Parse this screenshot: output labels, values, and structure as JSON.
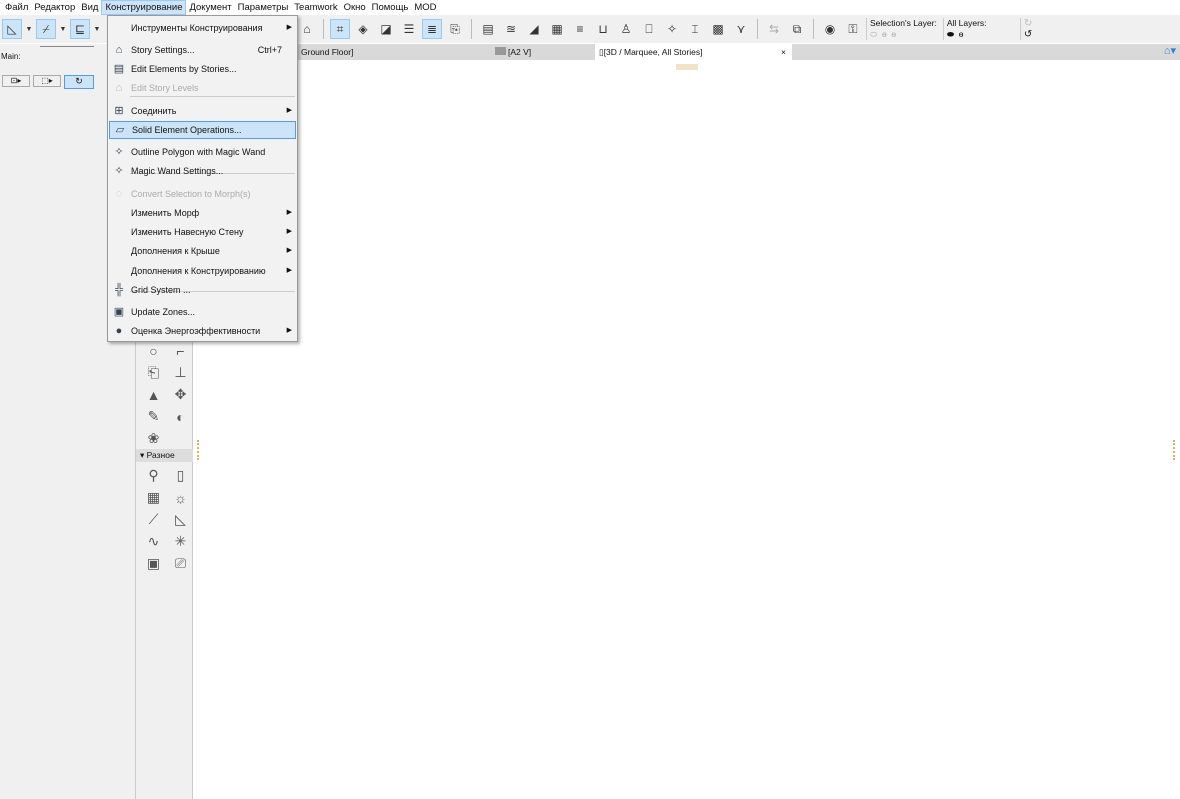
{
  "menubar": [
    "Файл",
    "Редактор",
    "Вид",
    "Конструирование",
    "Документ",
    "Параметры",
    "Teamwork",
    "Окно",
    "Помощь",
    "MOD"
  ],
  "active_menu": "Конструирование",
  "toolbar": {
    "selection_layer_label": "Selection's Layer:",
    "all_layers_label": "All Layers:"
  },
  "left_panel": {
    "main_label": "Main:"
  },
  "tabs": [
    "Ground Floor]",
    "[A2 V]",
    "[3D / Marquee, All Stories]"
  ],
  "tab_close": "×",
  "toolbox": {
    "group_label": "Разное",
    "icons1": [
      "○",
      "⌐",
      "⎗",
      "⊥",
      "▲",
      "✥",
      "✎",
      "◐",
      "❀"
    ],
    "icons2": [
      "⚲",
      "▯",
      "▦",
      "☼",
      "⟋",
      "◺",
      "∿",
      "✳",
      "▣",
      "⎚"
    ]
  },
  "menu": [
    {
      "label": "Инструменты Конструирования",
      "icon": "",
      "submenu": true
    },
    {
      "label": "Story Settings...",
      "icon": "⌂",
      "shortcut": "Ctrl+7"
    },
    {
      "label": "Edit Elements by Stories...",
      "icon": "▤"
    },
    {
      "label": "Edit Story Levels",
      "icon": "⌂",
      "disabled": true
    },
    {
      "label": "Соединить",
      "icon": "⊞",
      "submenu": true
    },
    {
      "label": "Solid Element Operations...",
      "icon": "▱",
      "highlighted": true
    },
    {
      "label": "Outline Polygon with Magic Wand",
      "icon": "✧"
    },
    {
      "label": "Magic Wand Settings...",
      "icon": "✧"
    },
    {
      "label": "Convert Selection to Morph(s)",
      "icon": "◌",
      "disabled": true
    },
    {
      "label": "Изменить Морф",
      "icon": "",
      "submenu": true
    },
    {
      "label": "Изменить Навесную Стену",
      "icon": "",
      "submenu": true
    },
    {
      "label": "Дополнения к Крыше",
      "icon": "",
      "submenu": true
    },
    {
      "label": "Дополнения к Конструированию",
      "icon": "",
      "submenu": true
    },
    {
      "label": "Grid System ...",
      "icon": "╬"
    },
    {
      "label": "Update Zones...",
      "icon": "▣"
    },
    {
      "label": "Оценка Энергоэффективности",
      "icon": "●",
      "submenu": true
    }
  ]
}
